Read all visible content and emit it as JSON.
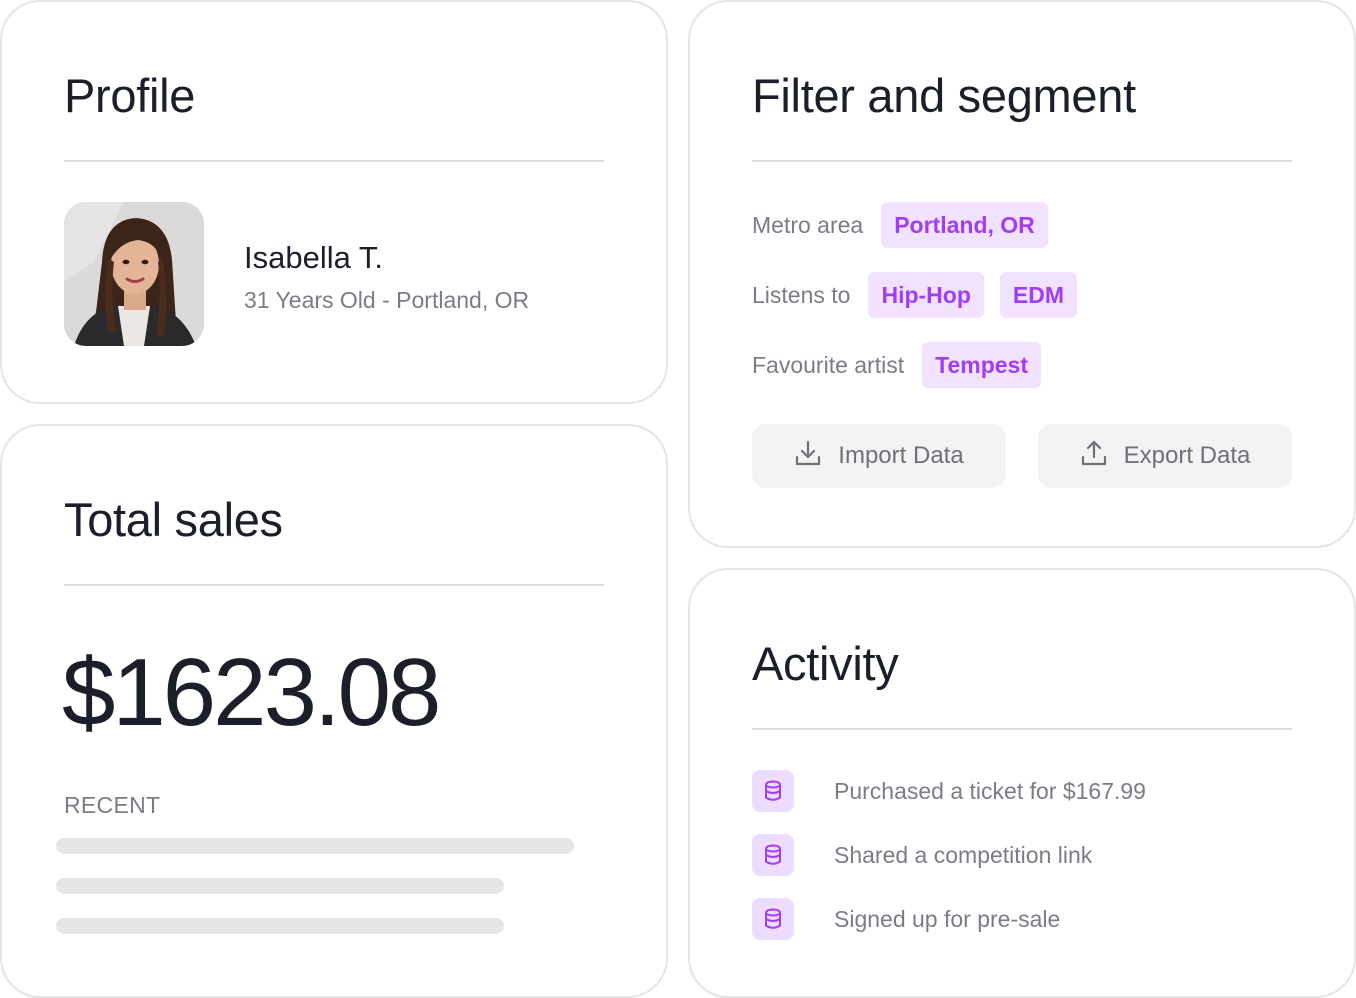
{
  "profile": {
    "title": "Profile",
    "name": "Isabella T.",
    "subtitle": "31 Years Old - Portland, OR"
  },
  "sales": {
    "title": "Total sales",
    "amount": "$1623.08",
    "recent_label": "RECENT"
  },
  "filter": {
    "title": "Filter and segment",
    "rows": [
      {
        "label": "Metro area",
        "chips": [
          "Portland, OR"
        ]
      },
      {
        "label": "Listens to",
        "chips": [
          "Hip-Hop",
          "EDM"
        ]
      },
      {
        "label": "Favourite artist",
        "chips": [
          "Tempest"
        ]
      }
    ],
    "import_label": "Import Data",
    "export_label": "Export Data",
    "import_icon": "download-icon",
    "export_icon": "upload-icon"
  },
  "activity": {
    "title": "Activity",
    "items": [
      {
        "icon": "database-icon",
        "text": "Purchased a ticket for $167.99"
      },
      {
        "icon": "database-icon",
        "text": "Shared a competition link"
      },
      {
        "icon": "database-icon",
        "text": "Signed up for pre-sale"
      }
    ]
  },
  "colors": {
    "accent": "#a23cf6",
    "chip_bg": "#f1e3ff",
    "text_primary": "#1b1f2a",
    "text_muted": "#7b7d85"
  }
}
